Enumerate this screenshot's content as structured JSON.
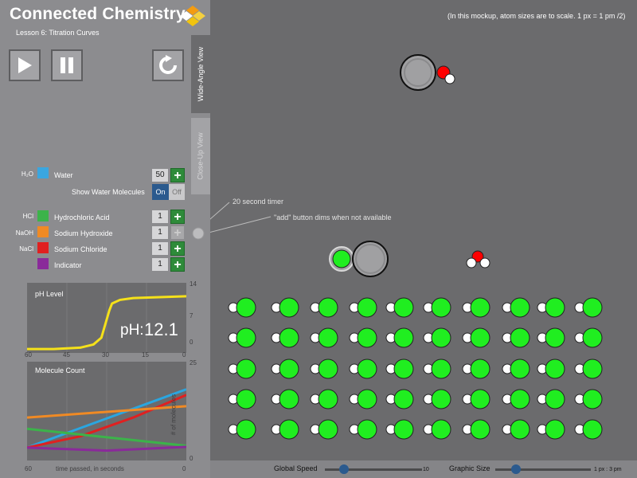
{
  "header": {
    "title": "Connected Chemistry",
    "lesson": "Lesson 6: Titration Curves"
  },
  "controls": {
    "play": "play-icon",
    "pause": "pause-icon",
    "reset": "reset-icon"
  },
  "tabs": [
    {
      "label": "Wide-Angle View",
      "active": true
    },
    {
      "label": "Close-Up View",
      "active": false
    }
  ],
  "reagents": [
    {
      "formula": "H₂O",
      "label": "Water",
      "count": "50",
      "color": "#3aa6e0",
      "add_enabled": true
    },
    {
      "formula": "HCl",
      "label": "Hydrochloric Acid",
      "count": "1",
      "color": "#3cb34a",
      "add_enabled": true
    },
    {
      "formula": "NaOH",
      "label": "Sodium Hydroxide",
      "count": "1",
      "color": "#f08a24",
      "add_enabled": false
    },
    {
      "formula": "NaCl",
      "label": "Sodium Chloride",
      "count": "1",
      "color": "#e02020",
      "add_enabled": true
    },
    {
      "formula": "",
      "label": "Indicator",
      "count": "1",
      "color": "#8a2a9a",
      "add_enabled": true
    }
  ],
  "water_toggle": {
    "label": "Show Water Molecules",
    "on": "On",
    "off": "Off"
  },
  "annotations": {
    "timer": "20 second timer",
    "add_dim": "\"add\" button dims when not available",
    "scale": "(In this mockup, atom sizes are to scale.  1 px = 1 pm /2)"
  },
  "ph_chart": {
    "title": "pH Level",
    "value_label": "pH:",
    "value": "12.1",
    "y_ticks": [
      "14",
      "7",
      "0"
    ],
    "x_ticks": [
      "60",
      "45",
      "30",
      "15",
      "0"
    ]
  },
  "count_chart": {
    "title": "Molecule Count",
    "y_ticks": [
      "25",
      "0"
    ],
    "x_ticks": [
      "60",
      "0"
    ],
    "xlabel": "time passed, in seconds",
    "ylabel": "# of molecules"
  },
  "chart_data": [
    {
      "type": "line",
      "title": "pH Level",
      "xlabel": "",
      "ylabel": "",
      "xlim": [
        60,
        0
      ],
      "ylim": [
        0,
        14
      ],
      "series": [
        {
          "color": "#f5e11a",
          "x": [
            60,
            50,
            40,
            35,
            32,
            31,
            30,
            29,
            28,
            25,
            20,
            10,
            0
          ],
          "y": [
            0.5,
            0.5,
            0.8,
            1.5,
            3,
            5,
            7,
            9,
            10.5,
            11.3,
            11.7,
            11.9,
            12.1
          ]
        }
      ]
    },
    {
      "type": "line",
      "title": "Molecule Count",
      "xlabel": "time passed, in seconds",
      "ylabel": "# of molecules",
      "xlim": [
        60,
        0
      ],
      "ylim": [
        0,
        25
      ],
      "series": [
        {
          "color": "#2aa6e0",
          "x": [
            60,
            0
          ],
          "y": [
            3,
            18.5
          ]
        },
        {
          "color": "#e02020",
          "x": [
            60,
            40,
            20,
            0
          ],
          "y": [
            3,
            6,
            11,
            17
          ]
        },
        {
          "color": "#f08a24",
          "x": [
            60,
            0
          ],
          "y": [
            11,
            14
          ]
        },
        {
          "color": "#3cb34a",
          "x": [
            60,
            0
          ],
          "y": [
            8,
            3.5
          ]
        },
        {
          "color": "#8a2a9a",
          "x": [
            60,
            30,
            0
          ],
          "y": [
            3,
            2.2,
            3.2
          ]
        }
      ]
    }
  ],
  "bottom": {
    "speed_label": "Global Speed",
    "speed_value": "10",
    "speed_level": 0.12,
    "size_label": "Graphic Size",
    "size_value": "1 px : 3 pm",
    "size_level": 0.15
  },
  "colors": {
    "sodium": "#a3a3a6",
    "oxygen": "#ff0000",
    "hydrogen": "#ffffff",
    "chloride": "#20ee20"
  }
}
